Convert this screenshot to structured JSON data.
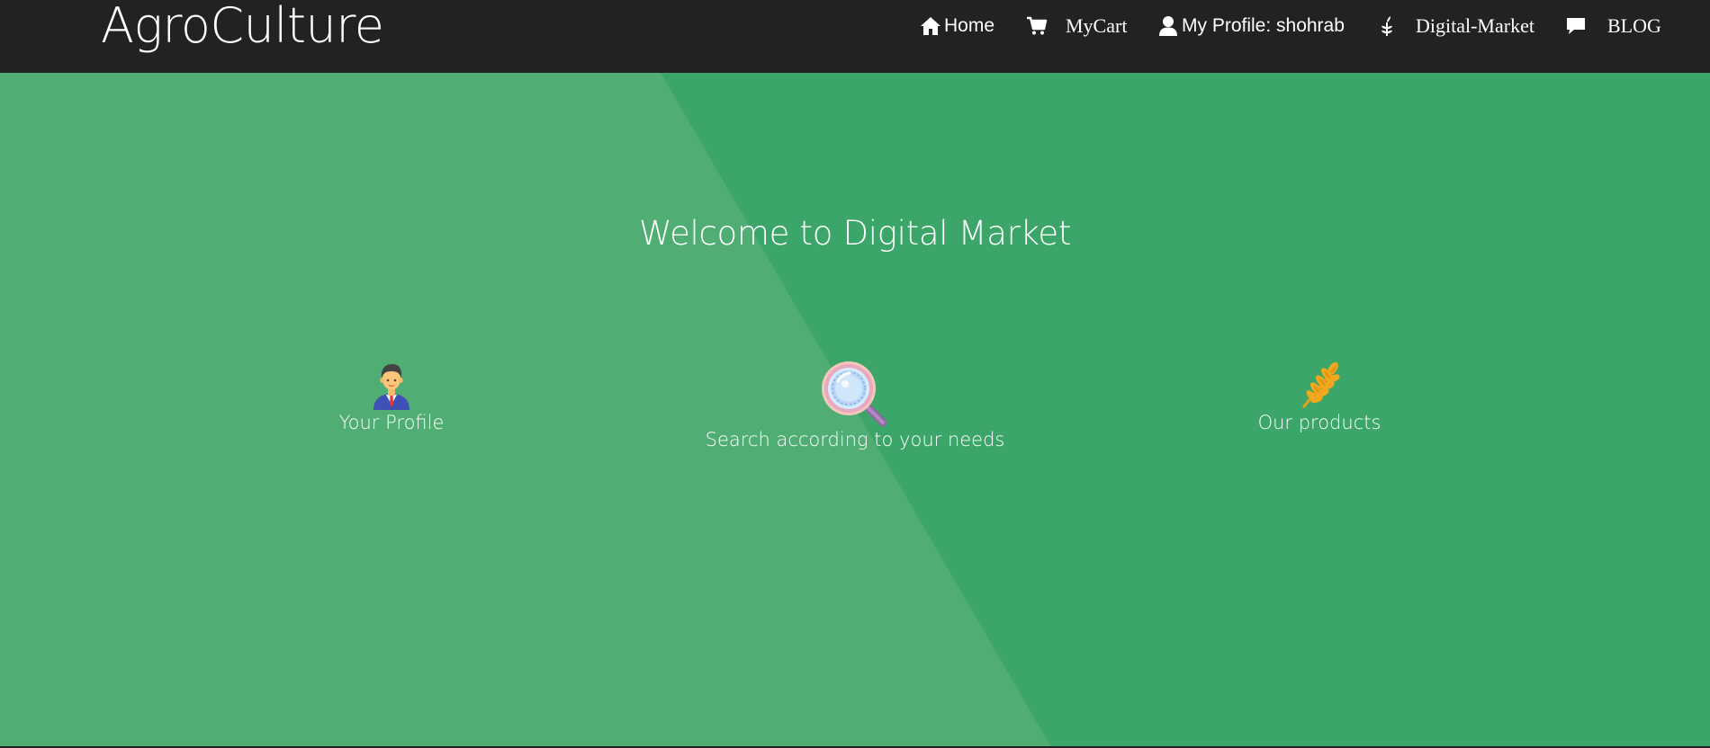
{
  "header": {
    "brand": "AgroCulture",
    "nav": {
      "home": {
        "label": "Home",
        "icon": "home-icon"
      },
      "cart": {
        "label": "MyCart",
        "icon": "cart-icon"
      },
      "profile": {
        "label": "My Profile: shohrab",
        "icon": "user-icon"
      },
      "market": {
        "label": "Digital-Market",
        "icon": "leaf-icon"
      },
      "blog": {
        "label": "BLOG",
        "icon": "comment-icon"
      }
    }
  },
  "hero": {
    "title": "Welcome to Digital Market",
    "features": [
      {
        "label": "Your Profile",
        "icon": "businessman-icon"
      },
      {
        "label": "Search according to your needs",
        "icon": "magnifying-glass-icon"
      },
      {
        "label": "Our products",
        "icon": "wheat-icon"
      }
    ]
  },
  "colors": {
    "navbar": "#212323",
    "hero_dark": "#3ca66a",
    "hero_light": "#50ad74",
    "text": "#ffffff"
  }
}
